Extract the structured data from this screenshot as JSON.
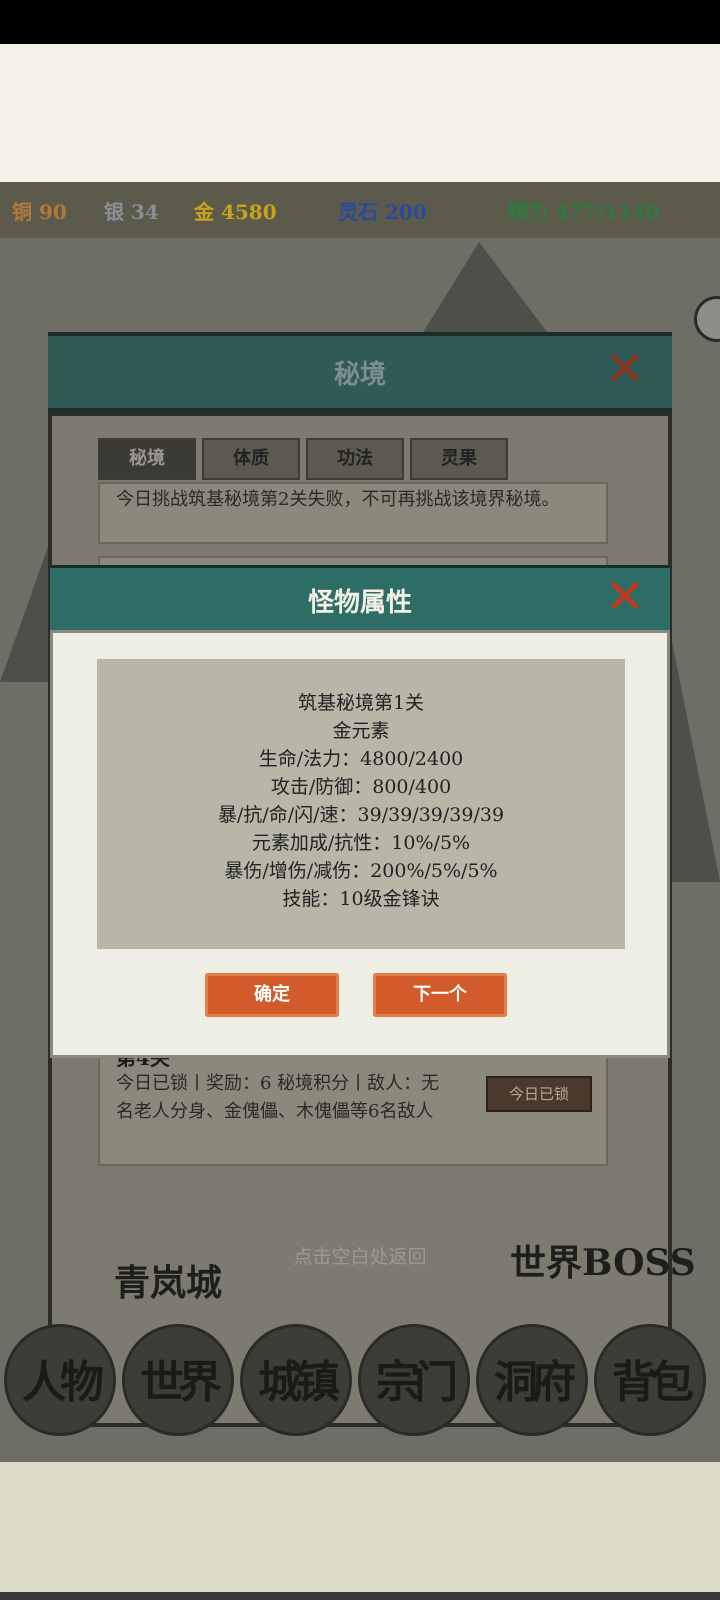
{
  "currency": {
    "copper": {
      "icon": "铜",
      "value": "90"
    },
    "silver": {
      "icon": "银",
      "value": "34"
    },
    "gold": {
      "icon": "金",
      "value": "4580"
    },
    "spirit_stone": "灵石 200",
    "energy": "精力 477/1140"
  },
  "base_dialog": {
    "title": "秘境",
    "tabs": [
      "秘境",
      "体质",
      "功法",
      "灵果"
    ],
    "notice": "今日挑战筑基秘境第2关失败，不可再挑战该境界秘境。",
    "level4": {
      "title": "第4关",
      "desc": "今日已锁丨奖励：6 秘境积分丨敌人：无名老人分身、金傀儡、木傀儡等6名敌人",
      "status_button": "今日已锁"
    }
  },
  "monster_modal": {
    "title": "怪物属性",
    "stats": [
      "筑基秘境第1关",
      "金元素",
      "生命/法力：4800/2400",
      "攻击/防御：800/400",
      "暴/抗/命/闪/速：39/39/39/39/39",
      "元素加成/抗性：10%/5%",
      "暴伤/增伤/减伤：200%/5%/5%",
      "技能：10级金锋诀"
    ],
    "confirm_label": "确定",
    "next_label": "下一个"
  },
  "hint": "点击空白处返回",
  "map_labels": {
    "city": "青岚城",
    "boss": "世界BOSS"
  },
  "nav": [
    {
      "label": "人物"
    },
    {
      "label": "世界"
    },
    {
      "label": "城镇"
    },
    {
      "label": "宗门"
    },
    {
      "label": "洞府"
    },
    {
      "label": "背包"
    }
  ],
  "colors": {
    "copper": "#b07a3a",
    "silver": "#8a8f96",
    "gold": "#c9a31c",
    "spirit": "#2a4aa0",
    "energy": "#2e7a40"
  }
}
